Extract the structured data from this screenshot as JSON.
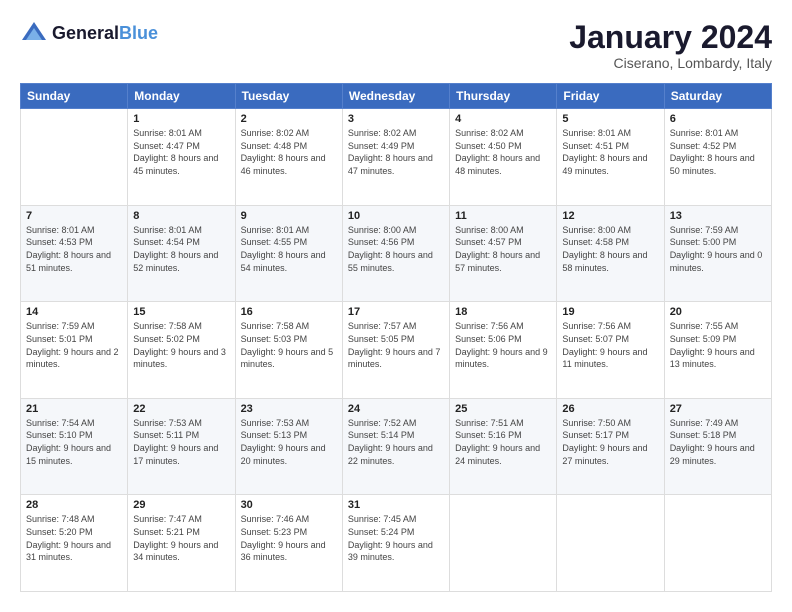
{
  "header": {
    "logo_line1": "General",
    "logo_line2": "Blue",
    "month_title": "January 2024",
    "location": "Ciserano, Lombardy, Italy"
  },
  "weekdays": [
    "Sunday",
    "Monday",
    "Tuesday",
    "Wednesday",
    "Thursday",
    "Friday",
    "Saturday"
  ],
  "weeks": [
    [
      {
        "day": "",
        "sunrise": "",
        "sunset": "",
        "daylight": ""
      },
      {
        "day": "1",
        "sunrise": "Sunrise: 8:01 AM",
        "sunset": "Sunset: 4:47 PM",
        "daylight": "Daylight: 8 hours and 45 minutes."
      },
      {
        "day": "2",
        "sunrise": "Sunrise: 8:02 AM",
        "sunset": "Sunset: 4:48 PM",
        "daylight": "Daylight: 8 hours and 46 minutes."
      },
      {
        "day": "3",
        "sunrise": "Sunrise: 8:02 AM",
        "sunset": "Sunset: 4:49 PM",
        "daylight": "Daylight: 8 hours and 47 minutes."
      },
      {
        "day": "4",
        "sunrise": "Sunrise: 8:02 AM",
        "sunset": "Sunset: 4:50 PM",
        "daylight": "Daylight: 8 hours and 48 minutes."
      },
      {
        "day": "5",
        "sunrise": "Sunrise: 8:01 AM",
        "sunset": "Sunset: 4:51 PM",
        "daylight": "Daylight: 8 hours and 49 minutes."
      },
      {
        "day": "6",
        "sunrise": "Sunrise: 8:01 AM",
        "sunset": "Sunset: 4:52 PM",
        "daylight": "Daylight: 8 hours and 50 minutes."
      }
    ],
    [
      {
        "day": "7",
        "sunrise": "Sunrise: 8:01 AM",
        "sunset": "Sunset: 4:53 PM",
        "daylight": "Daylight: 8 hours and 51 minutes."
      },
      {
        "day": "8",
        "sunrise": "Sunrise: 8:01 AM",
        "sunset": "Sunset: 4:54 PM",
        "daylight": "Daylight: 8 hours and 52 minutes."
      },
      {
        "day": "9",
        "sunrise": "Sunrise: 8:01 AM",
        "sunset": "Sunset: 4:55 PM",
        "daylight": "Daylight: 8 hours and 54 minutes."
      },
      {
        "day": "10",
        "sunrise": "Sunrise: 8:00 AM",
        "sunset": "Sunset: 4:56 PM",
        "daylight": "Daylight: 8 hours and 55 minutes."
      },
      {
        "day": "11",
        "sunrise": "Sunrise: 8:00 AM",
        "sunset": "Sunset: 4:57 PM",
        "daylight": "Daylight: 8 hours and 57 minutes."
      },
      {
        "day": "12",
        "sunrise": "Sunrise: 8:00 AM",
        "sunset": "Sunset: 4:58 PM",
        "daylight": "Daylight: 8 hours and 58 minutes."
      },
      {
        "day": "13",
        "sunrise": "Sunrise: 7:59 AM",
        "sunset": "Sunset: 5:00 PM",
        "daylight": "Daylight: 9 hours and 0 minutes."
      }
    ],
    [
      {
        "day": "14",
        "sunrise": "Sunrise: 7:59 AM",
        "sunset": "Sunset: 5:01 PM",
        "daylight": "Daylight: 9 hours and 2 minutes."
      },
      {
        "day": "15",
        "sunrise": "Sunrise: 7:58 AM",
        "sunset": "Sunset: 5:02 PM",
        "daylight": "Daylight: 9 hours and 3 minutes."
      },
      {
        "day": "16",
        "sunrise": "Sunrise: 7:58 AM",
        "sunset": "Sunset: 5:03 PM",
        "daylight": "Daylight: 9 hours and 5 minutes."
      },
      {
        "day": "17",
        "sunrise": "Sunrise: 7:57 AM",
        "sunset": "Sunset: 5:05 PM",
        "daylight": "Daylight: 9 hours and 7 minutes."
      },
      {
        "day": "18",
        "sunrise": "Sunrise: 7:56 AM",
        "sunset": "Sunset: 5:06 PM",
        "daylight": "Daylight: 9 hours and 9 minutes."
      },
      {
        "day": "19",
        "sunrise": "Sunrise: 7:56 AM",
        "sunset": "Sunset: 5:07 PM",
        "daylight": "Daylight: 9 hours and 11 minutes."
      },
      {
        "day": "20",
        "sunrise": "Sunrise: 7:55 AM",
        "sunset": "Sunset: 5:09 PM",
        "daylight": "Daylight: 9 hours and 13 minutes."
      }
    ],
    [
      {
        "day": "21",
        "sunrise": "Sunrise: 7:54 AM",
        "sunset": "Sunset: 5:10 PM",
        "daylight": "Daylight: 9 hours and 15 minutes."
      },
      {
        "day": "22",
        "sunrise": "Sunrise: 7:53 AM",
        "sunset": "Sunset: 5:11 PM",
        "daylight": "Daylight: 9 hours and 17 minutes."
      },
      {
        "day": "23",
        "sunrise": "Sunrise: 7:53 AM",
        "sunset": "Sunset: 5:13 PM",
        "daylight": "Daylight: 9 hours and 20 minutes."
      },
      {
        "day": "24",
        "sunrise": "Sunrise: 7:52 AM",
        "sunset": "Sunset: 5:14 PM",
        "daylight": "Daylight: 9 hours and 22 minutes."
      },
      {
        "day": "25",
        "sunrise": "Sunrise: 7:51 AM",
        "sunset": "Sunset: 5:16 PM",
        "daylight": "Daylight: 9 hours and 24 minutes."
      },
      {
        "day": "26",
        "sunrise": "Sunrise: 7:50 AM",
        "sunset": "Sunset: 5:17 PM",
        "daylight": "Daylight: 9 hours and 27 minutes."
      },
      {
        "day": "27",
        "sunrise": "Sunrise: 7:49 AM",
        "sunset": "Sunset: 5:18 PM",
        "daylight": "Daylight: 9 hours and 29 minutes."
      }
    ],
    [
      {
        "day": "28",
        "sunrise": "Sunrise: 7:48 AM",
        "sunset": "Sunset: 5:20 PM",
        "daylight": "Daylight: 9 hours and 31 minutes."
      },
      {
        "day": "29",
        "sunrise": "Sunrise: 7:47 AM",
        "sunset": "Sunset: 5:21 PM",
        "daylight": "Daylight: 9 hours and 34 minutes."
      },
      {
        "day": "30",
        "sunrise": "Sunrise: 7:46 AM",
        "sunset": "Sunset: 5:23 PM",
        "daylight": "Daylight: 9 hours and 36 minutes."
      },
      {
        "day": "31",
        "sunrise": "Sunrise: 7:45 AM",
        "sunset": "Sunset: 5:24 PM",
        "daylight": "Daylight: 9 hours and 39 minutes."
      },
      {
        "day": "",
        "sunrise": "",
        "sunset": "",
        "daylight": ""
      },
      {
        "day": "",
        "sunrise": "",
        "sunset": "",
        "daylight": ""
      },
      {
        "day": "",
        "sunrise": "",
        "sunset": "",
        "daylight": ""
      }
    ]
  ]
}
